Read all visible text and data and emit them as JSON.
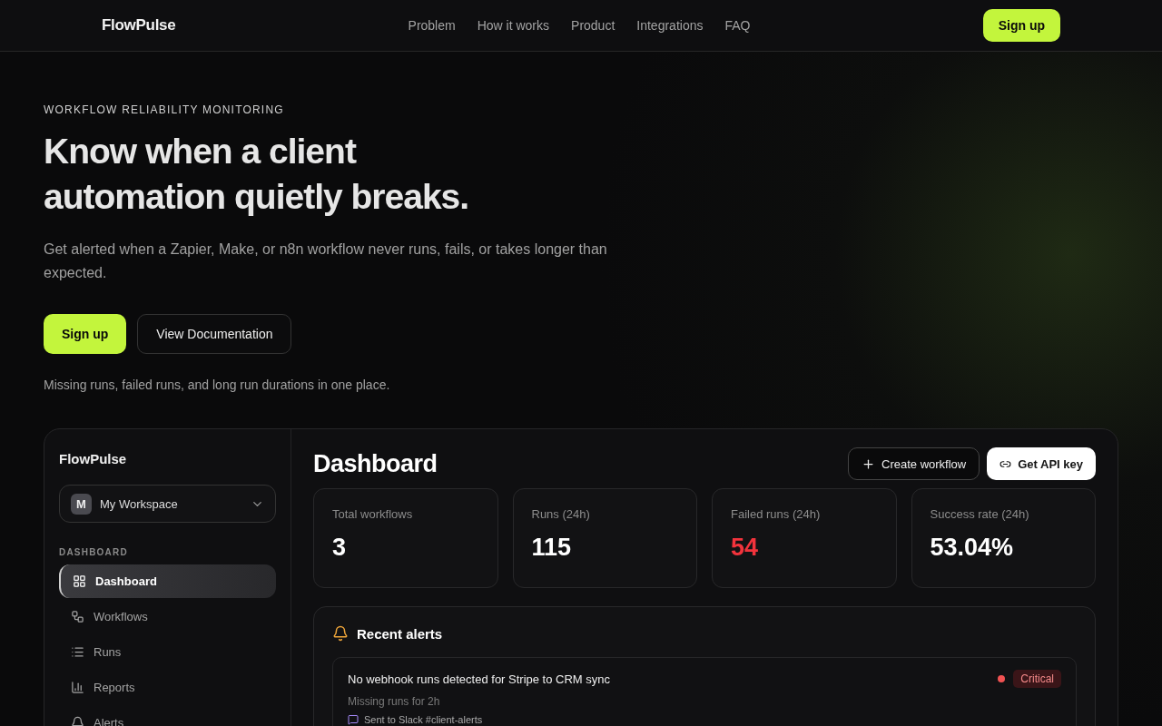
{
  "header": {
    "brand": "FlowPulse",
    "nav": [
      {
        "label": "Problem"
      },
      {
        "label": "How it works"
      },
      {
        "label": "Product"
      },
      {
        "label": "Integrations"
      },
      {
        "label": "FAQ"
      }
    ],
    "cta": "Sign up"
  },
  "hero": {
    "eyebrow": "WORKFLOW RELIABILITY MONITORING",
    "title_lines": [
      "Know when a client",
      "automation quietly breaks."
    ],
    "subtitle": "Get alerted when a Zapier, Make, or n8n workflow never runs, fails, or takes longer than expected.",
    "buttons": [
      {
        "label": "Sign up",
        "kind": "primary"
      },
      {
        "label": "View Documentation",
        "kind": "secondary"
      }
    ],
    "note": "Missing runs, failed runs, and long run durations in one place."
  },
  "app": {
    "sidebar": {
      "brand": "FlowPulse",
      "workspace": {
        "initial": "M",
        "name": "My Workspace"
      },
      "section": "DASHBOARD",
      "items": [
        {
          "label": "Dashboard",
          "kind": "grid",
          "selected": true
        },
        {
          "label": "Workflows",
          "kind": "workflow",
          "selected": false
        },
        {
          "label": "Runs",
          "kind": "list",
          "selected": false
        },
        {
          "label": "Reports",
          "kind": "chart",
          "selected": false
        },
        {
          "label": "Alerts",
          "kind": "bell",
          "selected": false
        }
      ]
    },
    "title": "Dashboard",
    "actions": [
      {
        "label": "Create workflow",
        "kind": "outline"
      },
      {
        "label": "Get API key",
        "kind": "solid"
      }
    ],
    "stats": [
      {
        "label": "Total workflows",
        "value": "3",
        "kind": "normal"
      },
      {
        "label": "Runs (24h)",
        "value": "115",
        "kind": "normal"
      },
      {
        "label": "Failed runs (24h)",
        "value": "54",
        "kind": "danger"
      },
      {
        "label": "Success rate (24h)",
        "value": "53.04%",
        "kind": "normal"
      }
    ],
    "alerts": {
      "title": "Recent alerts",
      "items": [
        {
          "title": "No webhook runs detected for Stripe to CRM sync",
          "detail": "Missing runs for 2h",
          "channel": "Sent to Slack #client-alerts",
          "severity": "Critical",
          "color": "#f05252"
        }
      ]
    }
  }
}
